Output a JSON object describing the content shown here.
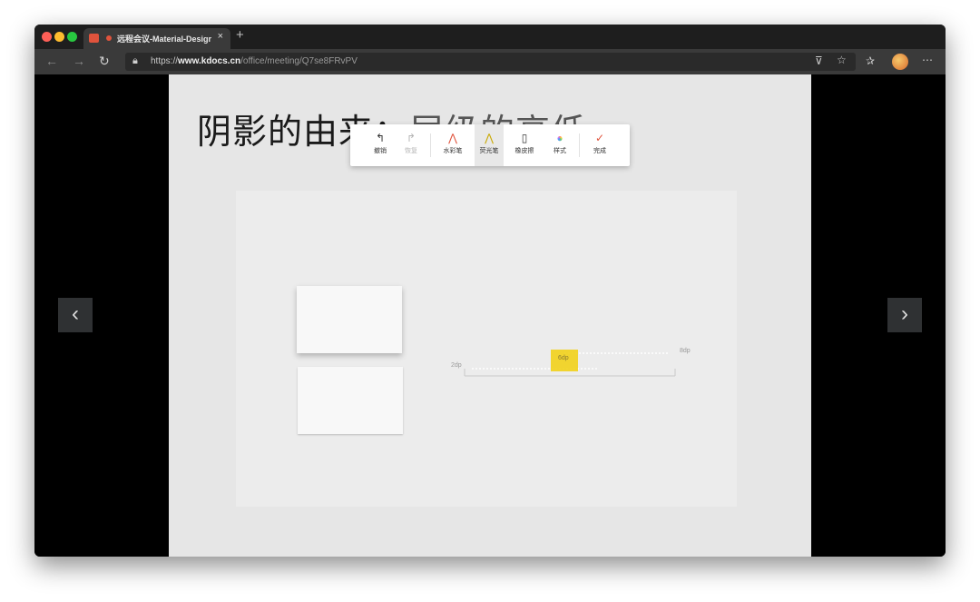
{
  "browser": {
    "tab_title": "远程会议-Material-Design",
    "tab_close": "×",
    "new_tab": "+",
    "url_scheme": "https://",
    "url_host": "www.kdocs.cn",
    "url_path": "/office/meeting/Q7se8FRvPV",
    "icons": [
      "back-icon",
      "forward-icon",
      "reload-icon",
      "lock-icon",
      "mic-icon",
      "star-icon",
      "favorites-icon",
      "avatar",
      "more-icon"
    ]
  },
  "toolbar": {
    "tools": [
      {
        "glyph": "↰",
        "label": "撤销",
        "state": "normal"
      },
      {
        "glyph": "↱",
        "label": "恢复",
        "state": "disabled"
      },
      {
        "glyph": "⋀",
        "label": "水彩笔",
        "state": "normal"
      },
      {
        "glyph": "⋀",
        "label": "荧光笔",
        "state": "active"
      },
      {
        "glyph": "▯",
        "label": "橡皮擦",
        "state": "normal"
      },
      {
        "glyph": "●",
        "label": "样式",
        "state": "normal"
      },
      {
        "glyph": "✓",
        "label": "完成",
        "state": "normal"
      }
    ]
  },
  "slide": {
    "title_prefix": "阴影的由来：",
    "title_highlight": "层级的高低",
    "labels": {
      "dp2": "2dp",
      "dp6": "6dp",
      "dp8": "8dp"
    }
  },
  "nav": {
    "prev": "‹",
    "next": "›"
  },
  "colors": {
    "accent_red": "#e0533c",
    "highlight_yellow": "#f2d21b",
    "slide_bg": "#e6e6e6"
  }
}
